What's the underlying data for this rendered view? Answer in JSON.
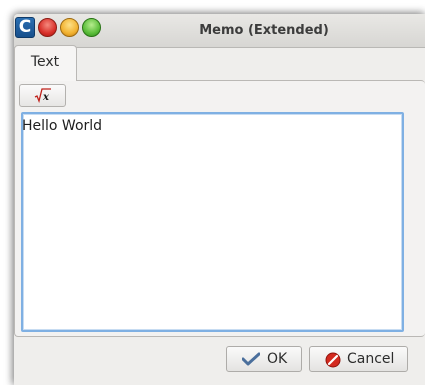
{
  "window": {
    "title": "Memo (Extended)",
    "app_icon_letter": "C"
  },
  "tabs": [
    {
      "label": "Text",
      "active": true
    }
  ],
  "toolbar": {
    "formula_icon": "sqrt-x-icon"
  },
  "memo": {
    "value": "Hello World"
  },
  "buttons": {
    "ok_label": "OK",
    "cancel_label": "Cancel"
  },
  "colors": {
    "focus_border": "#7fb0e3",
    "close": "#d8302a",
    "minimize": "#f2b231",
    "maximize": "#5bbd3a"
  }
}
